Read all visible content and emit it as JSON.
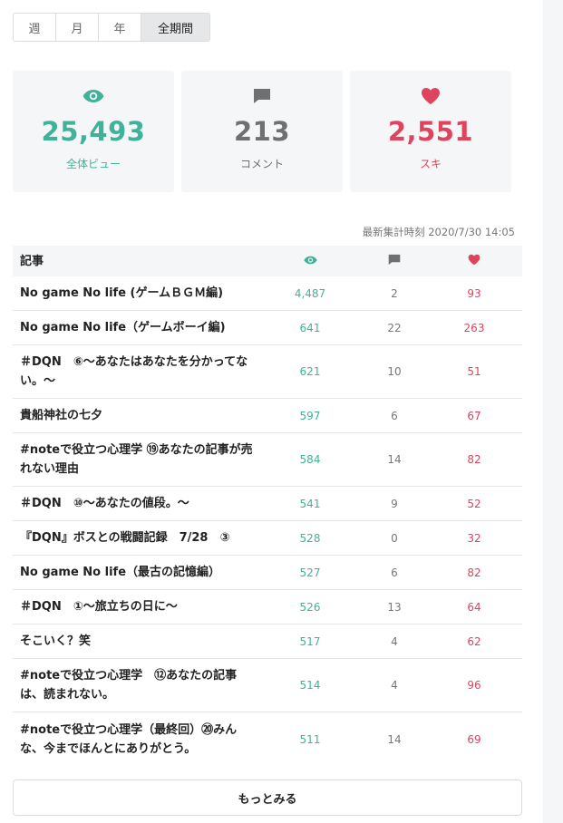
{
  "tabs": [
    {
      "label": "週",
      "active": false
    },
    {
      "label": "月",
      "active": false
    },
    {
      "label": "年",
      "active": false
    },
    {
      "label": "全期間",
      "active": true
    }
  ],
  "stats": {
    "views": {
      "value": "25,493",
      "label": "全体ビュー",
      "color": "#41b29a",
      "icon": "eye-icon"
    },
    "comments": {
      "value": "213",
      "label": "コメント",
      "color": "#707070",
      "icon": "comment-icon"
    },
    "likes": {
      "value": "2,551",
      "label": "スキ",
      "color": "#e0435e",
      "icon": "heart-icon"
    }
  },
  "updated_label": "最新集計時刻 2020/7/30 14:05",
  "table": {
    "header_title": "記事",
    "rows": [
      {
        "title": "No game No life (ゲームＢＧＭ編)",
        "views": "4,487",
        "comments": "2",
        "likes": "93"
      },
      {
        "title": "No game No life（ゲームボーイ編)",
        "views": "641",
        "comments": "22",
        "likes": "263"
      },
      {
        "title": "＃DQN　⑥～あなたはあなたを分かってない。～",
        "views": "621",
        "comments": "10",
        "likes": "51"
      },
      {
        "title": "貴船神社の七夕",
        "views": "597",
        "comments": "6",
        "likes": "67"
      },
      {
        "title": "#noteで役立つ心理学 ⑲あなたの記事が売れない理由",
        "views": "584",
        "comments": "14",
        "likes": "82"
      },
      {
        "title": "＃DQN　⑩～あなたの値段。～",
        "views": "541",
        "comments": "9",
        "likes": "52"
      },
      {
        "title": "『DQN』ボスとの戦闘記録　7/28　③",
        "views": "528",
        "comments": "0",
        "likes": "32"
      },
      {
        "title": "No game No life（最古の記憶編）",
        "views": "527",
        "comments": "6",
        "likes": "82"
      },
      {
        "title": "＃DQN　①～旅立ちの日に～",
        "views": "526",
        "comments": "13",
        "likes": "64"
      },
      {
        "title": "そこいく？笑",
        "views": "517",
        "comments": "4",
        "likes": "62"
      },
      {
        "title": "#noteで役立つ心理学　⑫あなたの記事は、読まれない。",
        "views": "514",
        "comments": "4",
        "likes": "96"
      },
      {
        "title": "#noteで役立つ心理学（最終回）⑳みんな、今までほんとにありがとう。",
        "views": "511",
        "comments": "14",
        "likes": "69"
      }
    ]
  },
  "more_label": "もっとみる"
}
